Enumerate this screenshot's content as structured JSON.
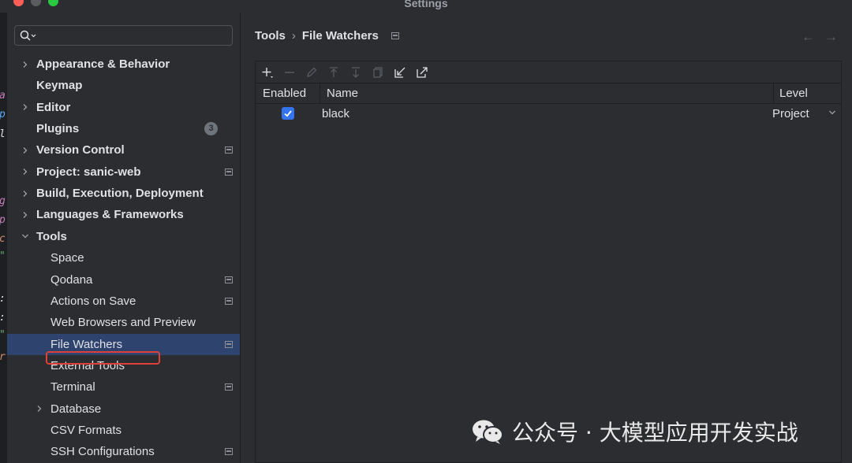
{
  "window": {
    "title": "Settings"
  },
  "editor_glyphs": [
    "a",
    "p",
    "l",
    "g",
    "p",
    "c",
    "\"",
    ":",
    ":",
    "\"",
    "r"
  ],
  "search": {
    "placeholder": ""
  },
  "sidebar": {
    "items": [
      {
        "label": "Appearance & Behavior",
        "expandable": true,
        "expanded": false
      },
      {
        "label": "Keymap"
      },
      {
        "label": "Editor",
        "expandable": true,
        "expanded": false
      },
      {
        "label": "Plugins",
        "badge": "3"
      },
      {
        "label": "Version Control",
        "expandable": true,
        "expanded": false,
        "setting_icon": true
      },
      {
        "label": "Project: sanic-web",
        "expandable": true,
        "expanded": false,
        "setting_icon": true
      },
      {
        "label": "Build, Execution, Deployment",
        "expandable": true,
        "expanded": false
      },
      {
        "label": "Languages & Frameworks",
        "expandable": true,
        "expanded": false
      },
      {
        "label": "Tools",
        "expandable": true,
        "expanded": true
      },
      {
        "label": "Space"
      },
      {
        "label": "Qodana",
        "setting_icon": true
      },
      {
        "label": "Actions on Save",
        "setting_icon": true
      },
      {
        "label": "Web Browsers and Preview"
      },
      {
        "label": "File Watchers",
        "setting_icon": true,
        "selected": true
      },
      {
        "label": "External Tools"
      },
      {
        "label": "Terminal",
        "setting_icon": true
      },
      {
        "label": "Database",
        "expandable": true,
        "expanded": false
      },
      {
        "label": "CSV Formats"
      },
      {
        "label": "SSH Configurations",
        "setting_icon": true
      }
    ]
  },
  "breadcrumb": {
    "parent": "Tools",
    "separator": "›",
    "current": "File Watchers"
  },
  "nav": {
    "back": "←",
    "forward": "→"
  },
  "toolbar": {
    "icons": [
      "add-icon",
      "remove-icon",
      "edit-icon",
      "move-up-icon",
      "move-down-icon",
      "copy-icon",
      "import-icon",
      "export-icon"
    ]
  },
  "table": {
    "columns": {
      "enabled": "Enabled",
      "name": "Name",
      "level": "Level"
    },
    "rows": [
      {
        "enabled": true,
        "name": "black",
        "level": "Project"
      }
    ]
  },
  "watermark": {
    "text": "公众号 · 大模型应用开发实战"
  },
  "colors": {
    "accent": "#3574f0",
    "selection": "#2e436e",
    "highlight_box": "#e0403a",
    "background": "#2b2d30"
  }
}
